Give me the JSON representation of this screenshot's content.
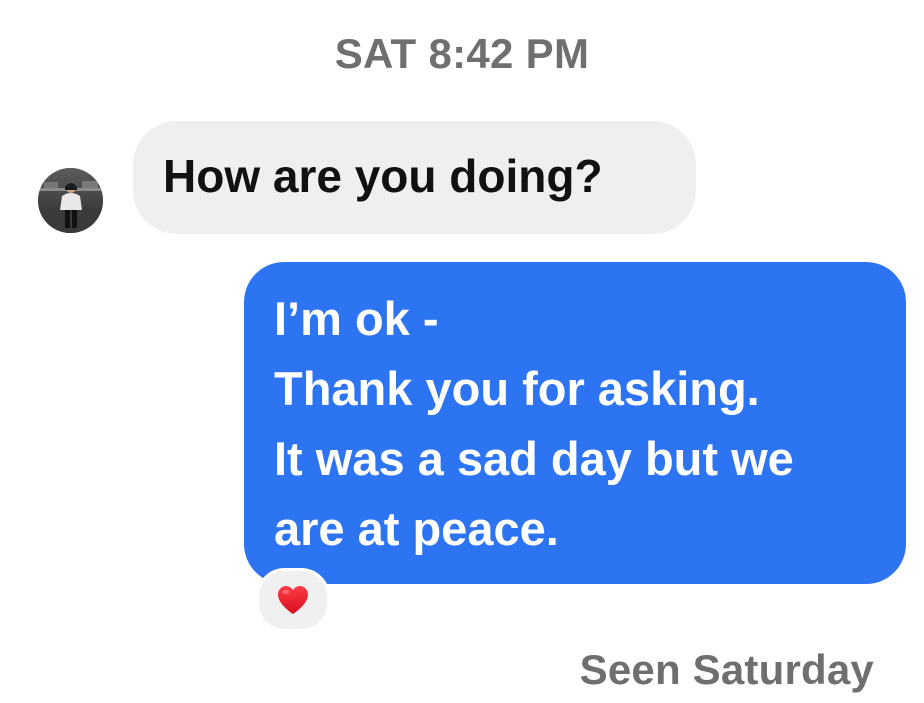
{
  "conversation": {
    "timestamp": "SAT 8:42 PM",
    "incoming": {
      "text": "How are you doing?",
      "avatar": {
        "icon": "profile-photo-icon"
      }
    },
    "outgoing": {
      "lines": [
        "I’m ok -",
        "Thank you for asking.",
        "It was a sad day but we",
        "are at peace."
      ],
      "reaction": {
        "icon": "red-heart-icon",
        "color": "#e8202e"
      }
    },
    "receipt": "Seen Saturday"
  },
  "colors": {
    "outgoing_bubble": "#2d74f3",
    "incoming_bubble": "#efefef",
    "meta_text": "#6f6f6f"
  }
}
